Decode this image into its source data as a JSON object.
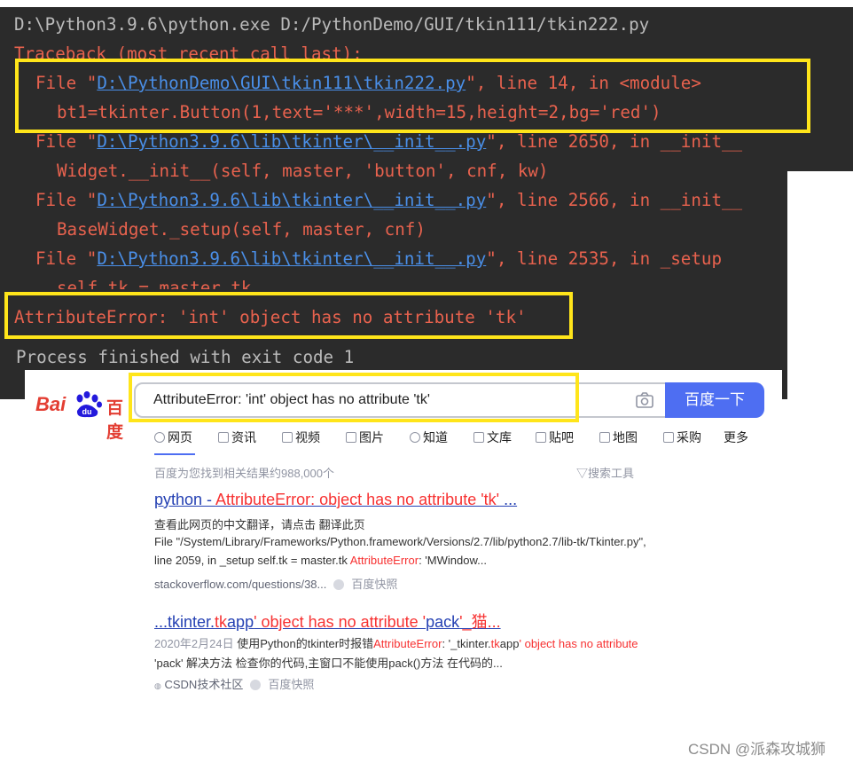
{
  "terminal": {
    "command": "D:\\Python3.9.6\\python.exe D:/PythonDemo/GUI/tkin111/tkin222.py",
    "traceback_header": "Traceback (most recent call last):",
    "frames": [
      {
        "prefix": "File \"",
        "path": "D:\\PythonDemo\\GUI\\tkin111\\tkin222.py",
        "suffix": "\", line 14, in <module>",
        "code": "bt1=tkinter.Button(1,text='***',width=15,height=2,bg='red')"
      },
      {
        "prefix": "File \"",
        "path": "D:\\Python3.9.6\\lib\\tkinter\\__init__.py",
        "suffix": "\", line 2650, in __init__",
        "code": "Widget.__init__(self, master, 'button', cnf, kw)"
      },
      {
        "prefix": "File \"",
        "path": "D:\\Python3.9.6\\lib\\tkinter\\__init__.py",
        "suffix": "\", line 2566, in __init__",
        "code": "BaseWidget._setup(self, master, cnf)"
      },
      {
        "prefix": "File \"",
        "path": "D:\\Python3.9.6\\lib\\tkinter\\__init__.py",
        "suffix": "\", line 2535, in _setup",
        "code": "self.tk = master.tk"
      }
    ],
    "error": "AttributeError: 'int' object has no attribute 'tk'",
    "exit_message": "Process finished with exit code 1",
    "highlight_color": "#ffe51a"
  },
  "baidu": {
    "logo_bai": "Bai",
    "logo_du": "百度",
    "search_value": "AttributeError: 'int' object has no attribute 'tk'",
    "search_button": "百度一下",
    "tabs": [
      "网页",
      "资讯",
      "视频",
      "图片",
      "知道",
      "文库",
      "贴吧",
      "地图",
      "采购",
      "更多"
    ],
    "result_count": "百度为您找到相关结果约988,000个",
    "tools_label": "搜索工具",
    "results": [
      {
        "title_a": "python - ",
        "title_em": "AttributeError: object has no attribute 'tk'",
        "title_b": " ...",
        "line1": "查看此网页的中文翻译，请点击 翻译此页",
        "line2": "File \"/System/Library/Frameworks/Python.framework/Versions/2.7/lib/python2.7/lib-tk/Tkinter.py\",",
        "line3_a": "line 2059, in _setup self.tk = master.tk ",
        "line3_em": "AttributeError",
        "line3_b": ": 'MWindow...",
        "source": "stackoverflow.com/questions/38...",
        "cache": "百度快照"
      },
      {
        "title_a": "...tkinter.",
        "title_em1": "tk",
        "title_b": "app",
        "title_em2": "' object has no attribute '",
        "title_c": "pack",
        "title_em3": "'_猫...",
        "date": "2020年2月24日",
        "line1_a": " 使用Python的tkinter时报错",
        "line1_em": "AttributeError",
        "line1_b": ": '_tkinter.",
        "line1_em2": "tk",
        "line1_c": "app",
        "line1_em3": "' object has no attribute",
        "line2": "'pack' 解决方法 检查你的代码,主窗口不能使用pack()方法 在代码的...",
        "source": "CSDN技术社区",
        "cache": "百度快照"
      }
    ]
  },
  "watermark": "CSDN @派森攻城狮"
}
